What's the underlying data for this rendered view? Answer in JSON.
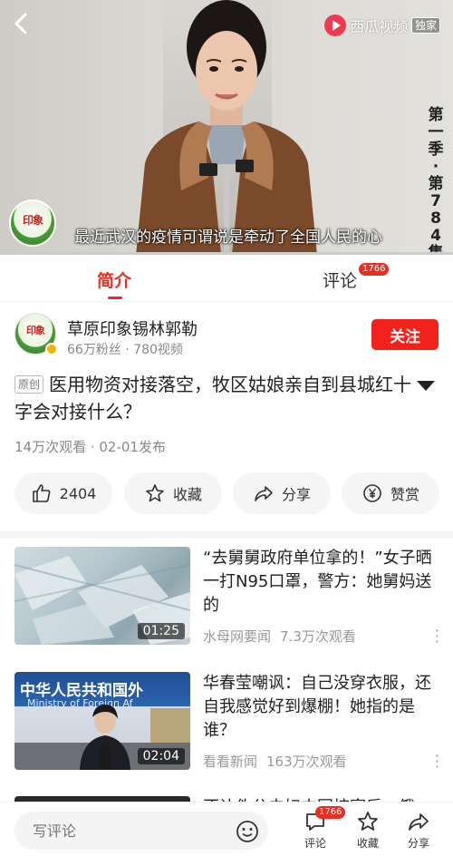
{
  "player": {
    "brand_name": "西瓜视频",
    "brand_tag": "独家",
    "season_label": "第一季·第784集",
    "logo_text": "印象",
    "subtitle": "最近武汉的疫情可谓说是牵动了全国人民的心",
    "progress": 0.0
  },
  "tabs": {
    "intro": "简介",
    "comments": "评论",
    "comments_badge": "1766"
  },
  "author": {
    "logo_text": "印象",
    "name": "草原印象锡林郭勒",
    "stats": "66万粉丝 · 780视频",
    "follow_label": "关注"
  },
  "video": {
    "original_tag": "原创",
    "title": "医用物资对接落空，牧区姑娘亲自到县城红十字会对接什么？",
    "meta": "14万次观看 · 02-01发布"
  },
  "actions": {
    "like_count": "2404",
    "collect_label": "收藏",
    "share_label": "分享",
    "reward_label": "赞赏"
  },
  "related": [
    {
      "title": "“去舅舅政府单位拿的！”女子晒一打N95口罩，警方：她舅妈送的",
      "duration": "01:25",
      "source": "水母网要闻",
      "views": "7.3万次观看"
    },
    {
      "title": "华春莹嘲讽：自己没穿衣服，还自我感觉好到爆棚！她指的是谁？",
      "duration": "02:04",
      "source": "看看新闻",
      "views": "163万次观看",
      "thumb_banner": "中华人民共和国外",
      "thumb_banner_en": "Ministry of Foreign Af"
    },
    {
      "title": "不让伪公夫妇中国按寝后，俄"
    }
  ],
  "bottombar": {
    "comment_placeholder": "写评论",
    "comments_label": "评论",
    "comments_badge": "1766",
    "collect_label": "收藏",
    "share_label": "分享"
  },
  "colors": {
    "accent": "#e63023",
    "follow_button": "#f2221b",
    "brand_red": "#f03a4e"
  }
}
